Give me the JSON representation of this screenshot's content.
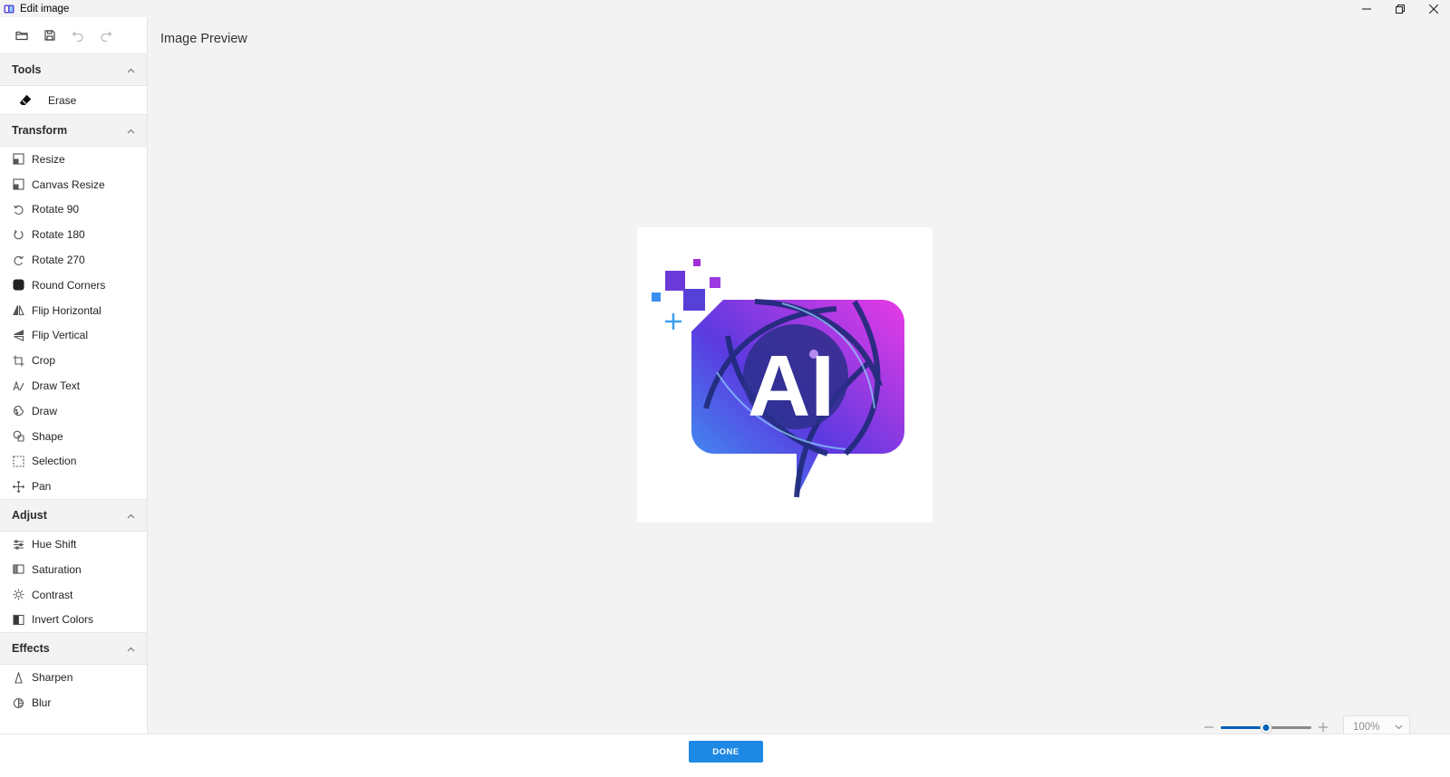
{
  "window": {
    "title": "Edit image",
    "controls": {
      "minimize": "minimize-icon",
      "maximize": "restore-icon",
      "close": "close-icon"
    }
  },
  "toolbar": {
    "buttons": [
      "open-folder-icon",
      "save-icon",
      "undo-icon",
      "redo-icon"
    ]
  },
  "sidebar": {
    "tools": {
      "title": "Tools",
      "items": [
        {
          "label": "Erase",
          "icon": "eraser-icon"
        }
      ]
    },
    "transform": {
      "title": "Transform",
      "items": [
        {
          "label": "Resize",
          "icon": "resize-icon"
        },
        {
          "label": "Canvas Resize",
          "icon": "canvas-resize-icon"
        },
        {
          "label": "Rotate 90",
          "icon": "rotate-90-icon"
        },
        {
          "label": "Rotate 180",
          "icon": "rotate-180-icon"
        },
        {
          "label": "Rotate 270",
          "icon": "rotate-270-icon"
        },
        {
          "label": "Round Corners",
          "icon": "round-corners-icon"
        },
        {
          "label": "Flip Horizontal",
          "icon": "flip-horizontal-icon"
        },
        {
          "label": "Flip Vertical",
          "icon": "flip-vertical-icon"
        },
        {
          "label": "Crop",
          "icon": "crop-icon"
        },
        {
          "label": "Draw Text",
          "icon": "draw-text-icon"
        },
        {
          "label": "Draw",
          "icon": "draw-icon"
        },
        {
          "label": "Shape",
          "icon": "shape-icon"
        },
        {
          "label": "Selection",
          "icon": "selection-icon"
        },
        {
          "label": "Pan",
          "icon": "pan-icon"
        }
      ]
    },
    "adjust": {
      "title": "Adjust",
      "items": [
        {
          "label": "Hue Shift",
          "icon": "hue-shift-icon"
        },
        {
          "label": "Saturation",
          "icon": "saturation-icon"
        },
        {
          "label": "Contrast",
          "icon": "contrast-icon"
        },
        {
          "label": "Invert Colors",
          "icon": "invert-colors-icon"
        }
      ]
    },
    "effects": {
      "title": "Effects",
      "items": [
        {
          "label": "Sharpen",
          "icon": "sharpen-icon"
        },
        {
          "label": "Blur",
          "icon": "blur-icon"
        }
      ]
    }
  },
  "main": {
    "preview_title": "Image Preview",
    "image": {
      "logo_text": "AI"
    }
  },
  "zoom": {
    "level": "100%",
    "slider_fraction": 0.5
  },
  "footer": {
    "done_label": "DONE"
  },
  "colors": {
    "accent": "#005fb8",
    "done_button": "#1e88e5",
    "logo_magenta": "#d63af0",
    "logo_blue": "#3a6ff0",
    "logo_navy": "#1e2a78"
  }
}
